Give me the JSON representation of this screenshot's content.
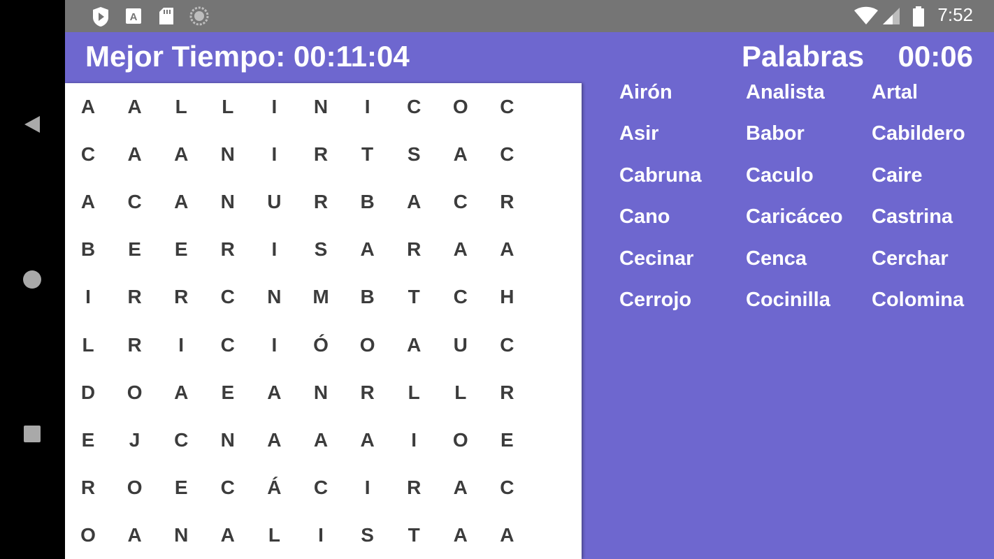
{
  "status_bar": {
    "time": "7:52",
    "icons": [
      "play-store-icon",
      "font-icon",
      "sd-card-icon",
      "loading-icon",
      "wifi-icon",
      "signal-icon",
      "battery-icon"
    ]
  },
  "nav_bar": {
    "buttons": [
      "back-icon",
      "home-icon",
      "recent-apps-icon"
    ]
  },
  "header": {
    "best_time": "Mejor Tiempo: 00:11:04",
    "words_title": "Palabras",
    "timer": "00:06"
  },
  "grid": [
    [
      "A",
      "A",
      "L",
      "L",
      "I",
      "N",
      "I",
      "C",
      "O",
      "C"
    ],
    [
      "C",
      "A",
      "A",
      "N",
      "I",
      "R",
      "T",
      "S",
      "A",
      "C"
    ],
    [
      "A",
      "C",
      "A",
      "N",
      "U",
      "R",
      "B",
      "A",
      "C",
      "R"
    ],
    [
      "B",
      "E",
      "E",
      "R",
      "I",
      "S",
      "A",
      "R",
      "A",
      "A"
    ],
    [
      "I",
      "R",
      "R",
      "C",
      "N",
      "M",
      "B",
      "T",
      "C",
      "H"
    ],
    [
      "L",
      "R",
      "I",
      "C",
      "I",
      "Ó",
      "O",
      "A",
      "U",
      "C"
    ],
    [
      "D",
      "O",
      "A",
      "E",
      "A",
      "N",
      "R",
      "L",
      "L",
      "R"
    ],
    [
      "E",
      "J",
      "C",
      "N",
      "A",
      "A",
      "A",
      "I",
      "O",
      "E"
    ],
    [
      "R",
      "O",
      "E",
      "C",
      "Á",
      "C",
      "I",
      "R",
      "A",
      "C"
    ],
    [
      "O",
      "A",
      "N",
      "A",
      "L",
      "I",
      "S",
      "T",
      "A",
      "A"
    ]
  ],
  "words": [
    "Airón",
    "Analista",
    "Artal",
    "Asir",
    "Babor",
    "Cabildero",
    "Cabruna",
    "Caculo",
    "Caire",
    "Cano",
    "Caricáceo",
    "Castrina",
    "Cecinar",
    "Cenca",
    "Cerchar",
    "Cerrojo",
    "Cocinilla",
    "Colomina"
  ],
  "colors": {
    "accent": "#6e67cf",
    "status_bar": "#757575",
    "grid_background": "#ffffff",
    "letter": "#3c3c3c"
  }
}
